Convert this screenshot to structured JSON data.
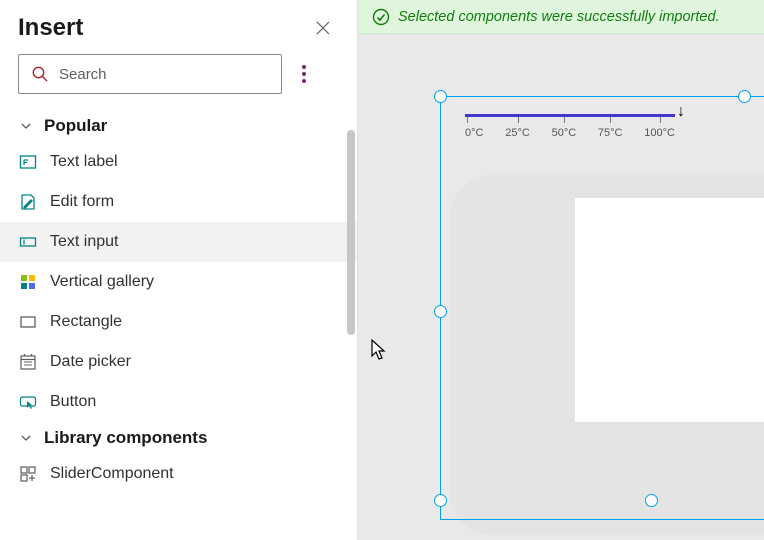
{
  "panel": {
    "title": "Insert",
    "search_placeholder": "Search",
    "sections": [
      {
        "label": "Popular",
        "items": [
          {
            "label": "Text label",
            "name": "text-label"
          },
          {
            "label": "Edit form",
            "name": "edit-form"
          },
          {
            "label": "Text input",
            "name": "text-input"
          },
          {
            "label": "Vertical gallery",
            "name": "vertical-gallery"
          },
          {
            "label": "Rectangle",
            "name": "rectangle"
          },
          {
            "label": "Date picker",
            "name": "date-picker"
          },
          {
            "label": "Button",
            "name": "button"
          }
        ]
      },
      {
        "label": "Library components",
        "items": [
          {
            "label": "SliderComponent",
            "name": "slider-component"
          }
        ]
      }
    ]
  },
  "banner": {
    "message": "Selected components were successfully imported."
  },
  "slider": {
    "ticks": [
      "0°C",
      "25°C",
      "50°C",
      "75°C",
      "100°C"
    ]
  }
}
